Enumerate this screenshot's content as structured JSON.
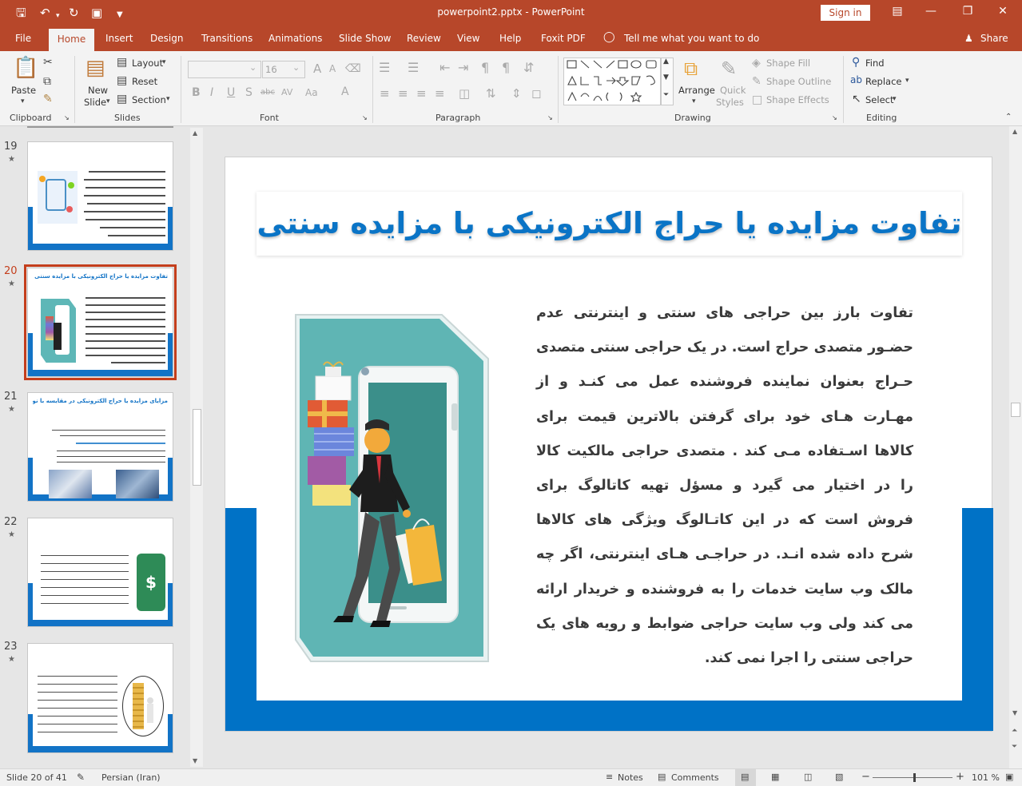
{
  "app": {
    "doc_title": "powerpoint2.pptx  -  PowerPoint",
    "signin_label": "Sign in"
  },
  "tabs": {
    "file": "File",
    "home": "Home",
    "insert": "Insert",
    "design": "Design",
    "transitions": "Transitions",
    "animations": "Animations",
    "slideshow": "Slide Show",
    "review": "Review",
    "view": "View",
    "help": "Help",
    "foxit": "Foxit PDF",
    "tellme": "Tell me what you want to do",
    "share": "Share"
  },
  "ribbon": {
    "clipboard": {
      "label": "Clipboard",
      "paste": "Paste"
    },
    "slides": {
      "label": "Slides",
      "new_slide_1": "New",
      "new_slide_2": "Slide",
      "layout": "Layout",
      "reset": "Reset",
      "section": "Section"
    },
    "font": {
      "label": "Font",
      "size": "16"
    },
    "paragraph": {
      "label": "Paragraph"
    },
    "drawing": {
      "label": "Drawing",
      "arrange": "Arrange",
      "quick_styles_1": "Quick",
      "quick_styles_2": "Styles",
      "shape_fill": "Shape Fill",
      "shape_outline": "Shape Outline",
      "shape_effects": "Shape Effects"
    },
    "editing": {
      "label": "Editing",
      "find": "Find",
      "replace": "Replace",
      "select": "Select"
    }
  },
  "thumbnails": [
    {
      "number": "19",
      "title": ""
    },
    {
      "number": "20",
      "title": "تفاوت مزایده یا حراج الکترونیکی با مزایده سنتی"
    },
    {
      "number": "21",
      "title": "مزایای مزایده یا حراج الکترونیکی در مقایسه با نوع سنتی"
    },
    {
      "number": "22",
      "title": ""
    },
    {
      "number": "23",
      "title": ""
    }
  ],
  "slide": {
    "title": "تفاوت مزایده یا حراج الکترونیکی با مزایده سنتی",
    "body": "تفاوت بارز بین حراجی های سنتی و اینترنتی عدم حضـور متصدی حراج است. در یک حراجی سنتی متصدی حـراج بعنوان نماینده فروشنده عمل می کنـد و از مهـارت هـای خود برای گرفتن بالاترین قیمت برای کالاها اسـتفاده مـی کند . متصدی حراجی مالکیت کالا را در اختیار می گیرد و مسؤل تهیه کاتالوگ برای فروش است که در این کاتـالوگ ویژگی های کالاها شرح داده شده انـد. در حراجـی هـای اینترنتی، اگر چه مالک وب سایت خدمات را به فروشنده و خریدار ارائه می کند ولی وب سایت حراجی ضوابط و رویه های یک حراجی سنتی را اجرا نمی کند."
  },
  "status": {
    "slide_info": "Slide 20 of 41",
    "language": "Persian (Iran)",
    "notes": "Notes",
    "comments": "Comments",
    "zoom": "101 %"
  },
  "colors": {
    "accent": "#b7472a",
    "slide_blue": "#0072c6",
    "title_blue": "#0a74c6"
  }
}
